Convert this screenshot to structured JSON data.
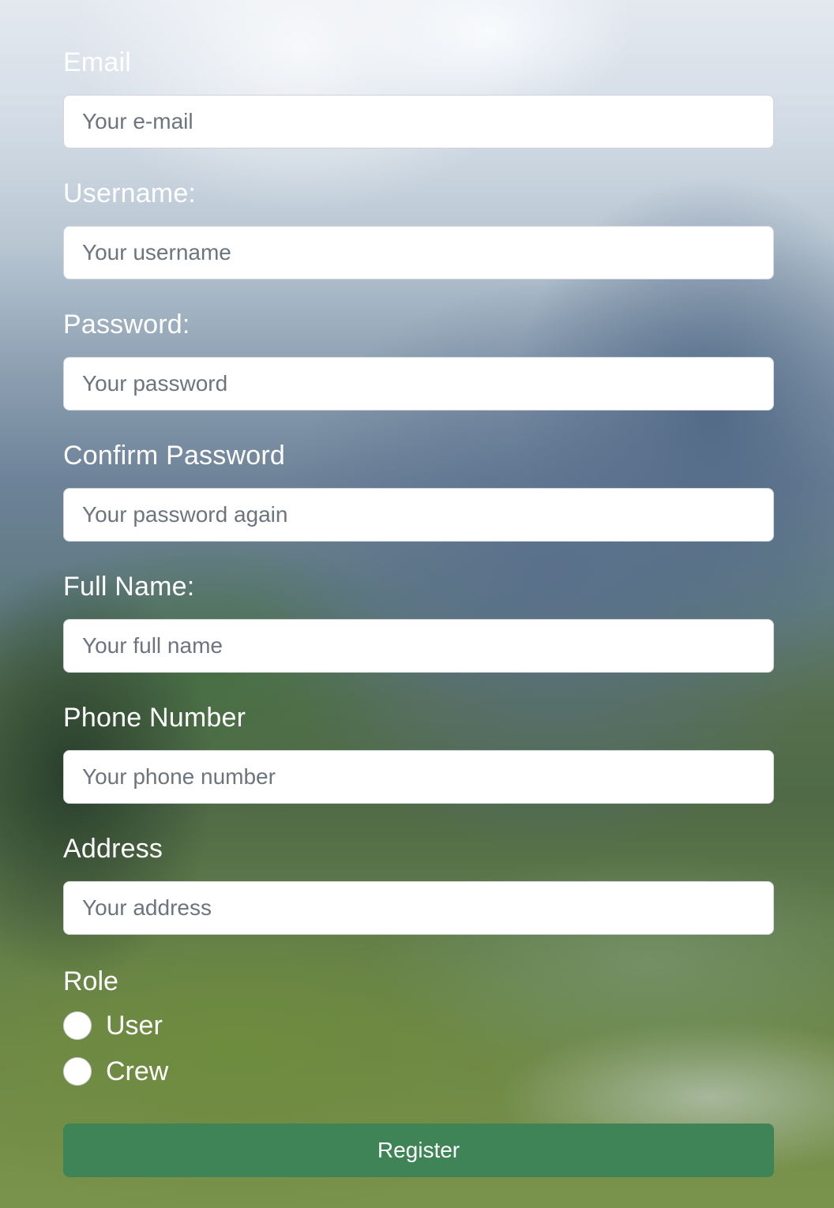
{
  "form": {
    "fields": [
      {
        "label": "Email",
        "placeholder": "Your e-mail",
        "value": ""
      },
      {
        "label": "Username:",
        "placeholder": "Your username",
        "value": ""
      },
      {
        "label": "Password:",
        "placeholder": "Your password",
        "value": ""
      },
      {
        "label": "Confirm Password",
        "placeholder": "Your password again",
        "value": ""
      },
      {
        "label": "Full Name:",
        "placeholder": "Your full name",
        "value": ""
      },
      {
        "label": "Phone Number",
        "placeholder": "Your phone number",
        "value": ""
      },
      {
        "label": "Address",
        "placeholder": "Your address",
        "value": ""
      }
    ],
    "role": {
      "label": "Role",
      "options": [
        {
          "label": "User",
          "checked": false
        },
        {
          "label": "Crew",
          "checked": false
        }
      ]
    },
    "submit_label": "Register"
  },
  "colors": {
    "button": "#3f8457",
    "label_text": "#ffffff",
    "input_background": "#ffffff",
    "placeholder_text": "#6c757d"
  }
}
